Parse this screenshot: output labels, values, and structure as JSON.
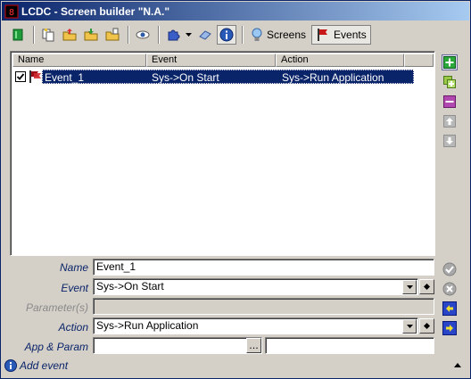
{
  "window": {
    "title": "LCDC - Screen builder \"N.A.\""
  },
  "toolbar": {
    "screens_label": "Screens",
    "events_label": "Events"
  },
  "events_table": {
    "columns": [
      "Name",
      "Event",
      "Action"
    ],
    "rows": [
      {
        "checked": true,
        "name": "Event_1",
        "event": "Sys->On Start",
        "action": "Sys->Run Application"
      }
    ]
  },
  "form": {
    "name_label": "Name",
    "name_value": "Event_1",
    "event_label": "Event",
    "event_value": "Sys->On Start",
    "parameters_label": "Parameter(s)",
    "parameters_value": "",
    "action_label": "Action",
    "action_value": "Sys->Run Application",
    "app_param_label": "App & Param",
    "app_value": "",
    "param_value": "",
    "browse_label": "..."
  },
  "status": {
    "text": "Add event"
  },
  "colors": {
    "title_gradient_start": "#0a246a",
    "title_gradient_end": "#a6caf0",
    "selection": "#0a246a",
    "label_blue": "#0a246a",
    "face": "#d4d0c8"
  }
}
